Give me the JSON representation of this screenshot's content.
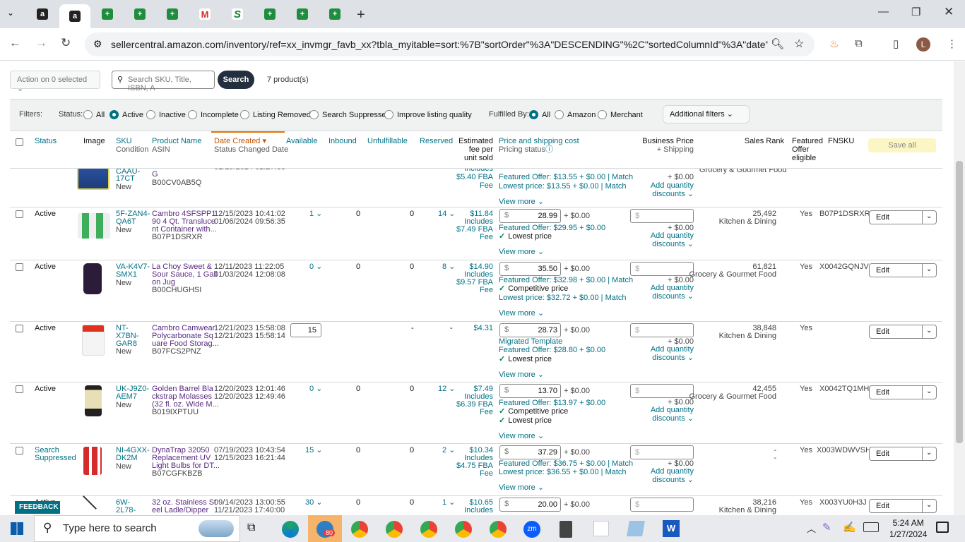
{
  "browser": {
    "url": "sellercentral.amazon.com/inventory/ref=xx_invmgr_favb_xx?tbla_myitable=sort:%7B\"sortOrder\"%3A\"DESCENDING\"%2C\"sortedColumnId\"%3A\"date\"...",
    "tabs": [
      "amazon-tab",
      "amazon-tab-active",
      "sheets-tab",
      "sheets-tab",
      "sheets-tab",
      "gmail-tab",
      "s-tab",
      "sheets-tab",
      "sheets-tab",
      "sheets-tab"
    ],
    "profile_initial": "L"
  },
  "toolbar": {
    "action_label": "Action on 0 selected",
    "search_placeholder": "Search SKU, Title, ISBN, A",
    "search_button": "Search",
    "product_count": "7 product(s)"
  },
  "filters": {
    "label": "Filters:",
    "status_label": "Status:",
    "status_options": [
      "All",
      "Active",
      "Inactive",
      "Incomplete",
      "Listing Removed",
      "Search Suppressed",
      "Improve listing quality"
    ],
    "status_selected": "Active",
    "fulfilled_label": "Fulfilled By:",
    "fulfilled_options": [
      "All",
      "Amazon",
      "Merchant"
    ],
    "fulfilled_selected": "All",
    "additional_filters": "Additional filters"
  },
  "columns": {
    "status": "Status",
    "image": "Image",
    "sku": "SKU",
    "sku_sub": "Condition",
    "product_name": "Product Name",
    "product_sub": "ASIN",
    "date_created": "Date Created",
    "date_sub": "Status Changed Date",
    "available": "Available",
    "inbound": "Inbound",
    "unfulfillable": "Unfulfillable",
    "reserved": "Reserved",
    "fee_1": "Estimated",
    "fee_2": "fee per",
    "fee_3": "unit sold",
    "price": "Price and shipping cost",
    "price_sub": "Pricing status",
    "business_price": "Business Price",
    "business_sub": "+ Shipping",
    "sales_rank": "Sales Rank",
    "featured_1": "Featured",
    "featured_2": "Offer",
    "featured_3": "eligible",
    "fnsku": "FNSKU",
    "save_all": "Save all"
  },
  "partial_row": {
    "sku": "CAAU-",
    "sku2": "17CT",
    "condition": "New",
    "name_end": "G",
    "asin": "B00CV0AB5Q",
    "date": "01/19/2024 02:27:33",
    "fee_a": "Includes",
    "fee_b": "$5.40 FBA",
    "fee_c": "Fee",
    "featured_offer": "Featured Offer: $13.55 + $0.00",
    "lowest": "Lowest price: $13.55 + $0.00",
    "match": "Match",
    "view_more": "View more",
    "biz_ship": "+ $0.00",
    "add_qty_1": "Add quantity",
    "add_qty_2": "discounts",
    "category": "Grocery & Gourmet Food"
  },
  "rows": [
    {
      "status": "Active",
      "sku1": "5F-ZAN4-",
      "sku2": "QA6T",
      "condition": "New",
      "name1": "Cambro 4SFSPP1",
      "name2": "90 4 Qt. Transluce",
      "name3": "nt Container with...",
      "asin": "B07P1DSRXR",
      "date1": "12/15/2023 10:41:02",
      "date2": "01/06/2024 09:56:35",
      "available": "1",
      "inbound": "0",
      "unfulfillable": "0",
      "reserved": "14",
      "fee1": "$11.84",
      "fee2": "Includes",
      "fee3": "$7.49 FBA",
      "fee4": "Fee",
      "price": "28.99",
      "ship": "+ $0.00",
      "line1": "Featured Offer: $29.95 + $0.00",
      "line2": "Lowest price",
      "line3": "",
      "view_more": "View more",
      "biz_ship": "+ $0.00",
      "add_qty_1": "Add quantity",
      "add_qty_2": "discounts",
      "rank": "25,492",
      "category": "Kitchen & Dining",
      "featured": "Yes",
      "fnsku": "B07P1DSRXR",
      "edit": "Edit"
    },
    {
      "status": "Active",
      "sku1": "VA-K4V7-",
      "sku2": "SMX1",
      "condition": "New",
      "name1": "La Choy Sweet &",
      "name2": "Sour Sauce, 1 Gall",
      "name3": "on Jug",
      "asin": "B00CHUGHSI",
      "date1": "12/11/2023 11:22:05",
      "date2": "01/03/2024 12:08:08",
      "available": "0",
      "inbound": "0",
      "unfulfillable": "0",
      "reserved": "8",
      "fee1": "$14.90",
      "fee2": "Includes",
      "fee3": "$9.57 FBA",
      "fee4": "Fee",
      "price": "35.50",
      "ship": "+ $0.00",
      "line1": "Featured Offer: $32.98 + $0.00",
      "line2": "Competitive price",
      "line3": "Lowest price: $32.72 + $0.00",
      "view_more": "View more",
      "biz_ship": "+ $0.00",
      "add_qty_1": "Add quantity",
      "add_qty_2": "discounts",
      "rank": "61,821",
      "category": "Grocery & Gourmet Food",
      "featured": "Yes",
      "fnsku": "X0042GQNJV",
      "edit": "Edit"
    },
    {
      "status": "Active",
      "sku1": "NT-",
      "sku2": "X7BN-",
      "sku3": "GAR8",
      "condition": "New",
      "name1": "Cambro Camwear",
      "name2": "Polycarbonate Sq",
      "name3": "uare Food Storag...",
      "asin": "B07FCS2PNZ",
      "date1": "12/21/2023 15:58:08",
      "date2": "12/21/2023 15:58:14",
      "available": "15",
      "inbound": "",
      "unfulfillable": "-",
      "reserved": "-",
      "fee1": "$4.31",
      "price": "28.73",
      "ship": "+ $0.00",
      "line0": "Migrated Template",
      "line1": "Featured Offer: $28.80 + $0.00",
      "line2": "Lowest price",
      "view_more": "View more",
      "biz_ship": "+ $0.00",
      "add_qty_1": "Add quantity",
      "add_qty_2": "discounts",
      "rank": "38,848",
      "category": "Kitchen & Dining",
      "featured": "Yes",
      "fnsku": "",
      "edit": "Edit"
    },
    {
      "status": "Active",
      "sku1": "UK-J9Z0-",
      "sku2": "AEM7",
      "condition": "New",
      "name1": "Golden Barrel Bla",
      "name2": "ckstrap Molasses",
      "name3": "(32 fl. oz. Wide M...",
      "asin": "B019IXPTUU",
      "date1": "12/20/2023 12:01:46",
      "date2": "12/20/2023 12:49:46",
      "available": "0",
      "inbound": "0",
      "unfulfillable": "0",
      "reserved": "12",
      "fee1": "$7.49",
      "fee2": "Includes",
      "fee3": "$6.39 FBA",
      "fee4": "Fee",
      "price": "13.70",
      "ship": "+ $0.00",
      "line1": "Featured Offer: $13.97 + $0.00",
      "line2": "Competitive price",
      "line3": "Lowest price",
      "view_more": "View more",
      "biz_ship": "+ $0.00",
      "add_qty_1": "Add quantity",
      "add_qty_2": "discounts",
      "rank": "42,455",
      "category": "Grocery & Gourmet Food",
      "featured": "Yes",
      "fnsku": "X0042TQ1MH",
      "edit": "Edit"
    },
    {
      "status": "Search",
      "status2": "Suppressed",
      "sku1": "NI-4GXX-",
      "sku2": "DK2M",
      "condition": "New",
      "name1": "DynaTrap 32050",
      "name2": "Replacement UV",
      "name3": "Light Bulbs for DT...",
      "asin": "B07CGFKBZB",
      "date1": "07/19/2023 10:43:54",
      "date2": "12/15/2023 16:21:44",
      "available": "15",
      "inbound": "0",
      "unfulfillable": "0",
      "reserved": "2",
      "fee1": "$10.34",
      "fee2": "Includes",
      "fee3": "$4.75 FBA",
      "fee4": "Fee",
      "price": "37.29",
      "ship": "+ $0.00",
      "line1": "Featured Offer: $36.75 + $0.00",
      "line3": "Lowest price: $36.55 + $0.00",
      "view_more": "View more",
      "biz_ship": "+ $0.00",
      "add_qty_1": "Add quantity",
      "add_qty_2": "discounts",
      "rank": "-",
      "rank2": "-",
      "featured": "Yes",
      "fnsku": "X003WDWVSH",
      "edit": "Edit"
    },
    {
      "status": "Active",
      "sku1": "6W-",
      "sku2": "2L78-",
      "name1": "32 oz. Stainless St",
      "name2": "eel Ladle/Dipper",
      "date1": "09/14/2023 13:00:55",
      "date2": "11/21/2023 17:40:00",
      "available": "30",
      "inbound": "0",
      "unfulfillable": "0",
      "reserved": "1",
      "fee1": "$10.65",
      "fee2": "Includes",
      "price": "20.00",
      "ship": "+ $0.00",
      "rank": "38,216",
      "category": "Kitchen & Dining",
      "featured": "Yes",
      "fnsku": "X003YU0H3J",
      "edit": "Edit"
    }
  ],
  "match_label": "Match",
  "feedback": "FEEDBACK",
  "taskbar": {
    "search_placeholder": "Type here to search",
    "time": "5:24 AM",
    "date": "1/27/2024",
    "badge": "80"
  }
}
